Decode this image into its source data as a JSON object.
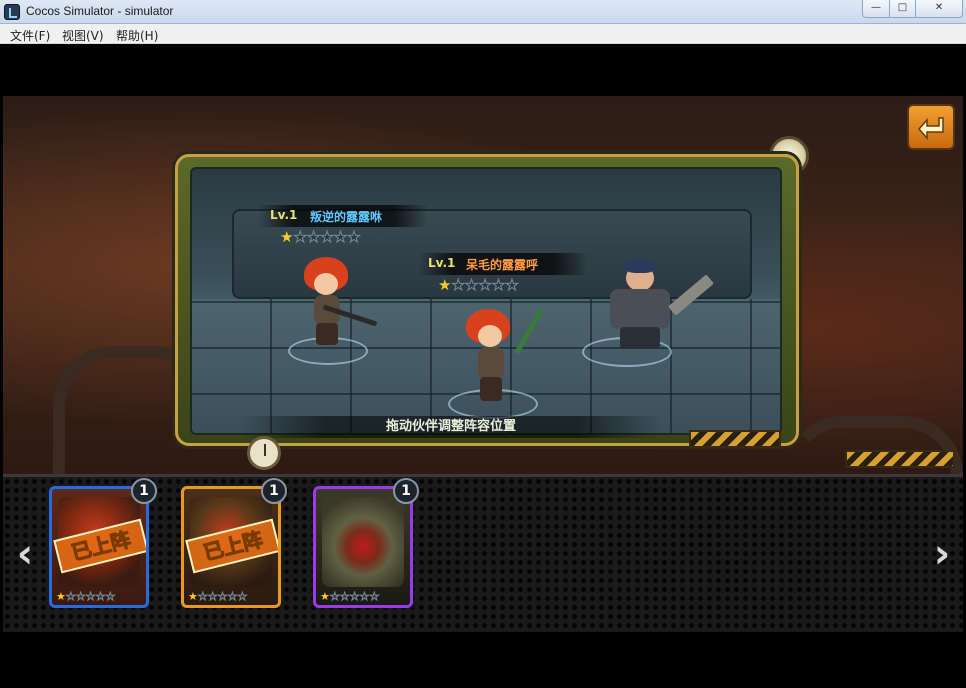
{
  "window": {
    "title": "Cocos Simulator - simulator",
    "min_label": "—",
    "max_label": "□",
    "close_label": "✕"
  },
  "menu": [
    {
      "label": "文件(F)"
    },
    {
      "label": "视图(V)"
    },
    {
      "label": "帮助(H)"
    }
  ],
  "stage": {
    "hint": "拖动伙伴调整阵容位置",
    "characters": [
      {
        "level": "Lv.1",
        "name": "叛逆的露露咻",
        "name_color": "#5ec8ff",
        "stars_filled": 1,
        "stars_total": 6
      },
      {
        "level": "Lv.1",
        "name": "呆毛的露露呼",
        "name_color": "#ff9a40",
        "stars_filled": 1,
        "stars_total": 6
      }
    ]
  },
  "cards": [
    {
      "level": "1",
      "deployed_label": "已上阵",
      "stars_filled": 1,
      "stars_total": 6,
      "border": "#2a6adf"
    },
    {
      "level": "1",
      "deployed_label": "已上阵",
      "stars_filled": 1,
      "stars_total": 6,
      "border": "#e89a20"
    },
    {
      "level": "1",
      "deployed_label": "",
      "stars_filled": 1,
      "stars_total": 6,
      "border": "#9a3ae8"
    }
  ],
  "nav": {
    "prev_icon": "chevron-left-icon",
    "next_icon": "chevron-right-icon",
    "back_icon": "return-arrow-icon"
  }
}
